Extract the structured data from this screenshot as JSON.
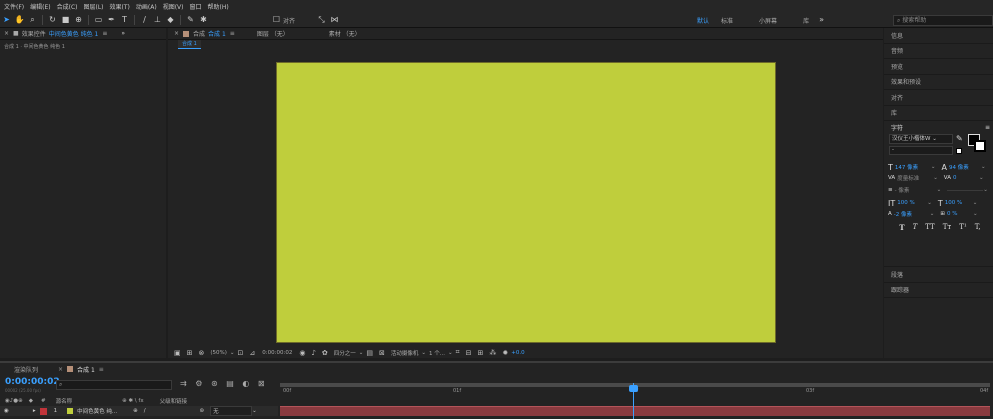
{
  "menu": [
    "文件(F)",
    "编辑(E)",
    "合成(C)",
    "图层(L)",
    "效果(T)",
    "动画(A)",
    "视图(V)",
    "窗口",
    "帮助(H)"
  ],
  "toolbar": {
    "align_label": "对齐",
    "workspaces": [
      "默认",
      "标准",
      "小屏幕",
      "库"
    ],
    "search_placeholder": "搜索帮助"
  },
  "left_panel": {
    "tab_label": "效果控件",
    "tab_target": "中间色黄色 纯色 1",
    "breadcrumb": "合成 1 · 中间色黄色 纯色 1"
  },
  "viewer": {
    "tab_label": "合成",
    "comp_name": "合成 1",
    "layer_tab": "图层 （无）",
    "footage_tab": "素材 （无）",
    "flow_chip": "合成 1",
    "canvas_color": "#bfce3c",
    "bottom": {
      "zoom": "(50%)",
      "timecode": "0:00:00:02",
      "resolution": "四分之一",
      "camera": "活动摄像机",
      "views": "1 个...",
      "exposure": "+0.0"
    }
  },
  "right_panel": {
    "sections": [
      "信息",
      "音频",
      "预览",
      "效果和预设",
      "对齐",
      "库"
    ],
    "character": {
      "title": "字符",
      "font": "汉仪王小楷体W",
      "style": "-",
      "size": "147 像素",
      "leading": "94 像素",
      "kerning": "度量标准",
      "tracking": "0",
      "stroke": "- 像素",
      "vscale": "100 %",
      "hscale": "100 %",
      "baseline": "-2 像素",
      "tsume": "0 %",
      "styles": [
        "T",
        "T",
        "TT",
        "Tт",
        "T¹",
        "T,"
      ]
    },
    "paragraph": "段落",
    "tracker": "跟踪器"
  },
  "timeline": {
    "render_tab": "渲染队列",
    "comp_tab": "合成 1",
    "timecode": "0:00:00:02",
    "frame_info": "00002 (25.00 fps)",
    "col_source": "源名称",
    "col_parent": "父级和链接",
    "layer": {
      "index": "1",
      "name": "中间色黄色 纯...",
      "parent": "无",
      "color": "#c0343a"
    },
    "ruler": [
      "00f",
      "01f",
      "02f",
      "03f",
      "04f"
    ],
    "playhead_fraction": 0.5
  }
}
